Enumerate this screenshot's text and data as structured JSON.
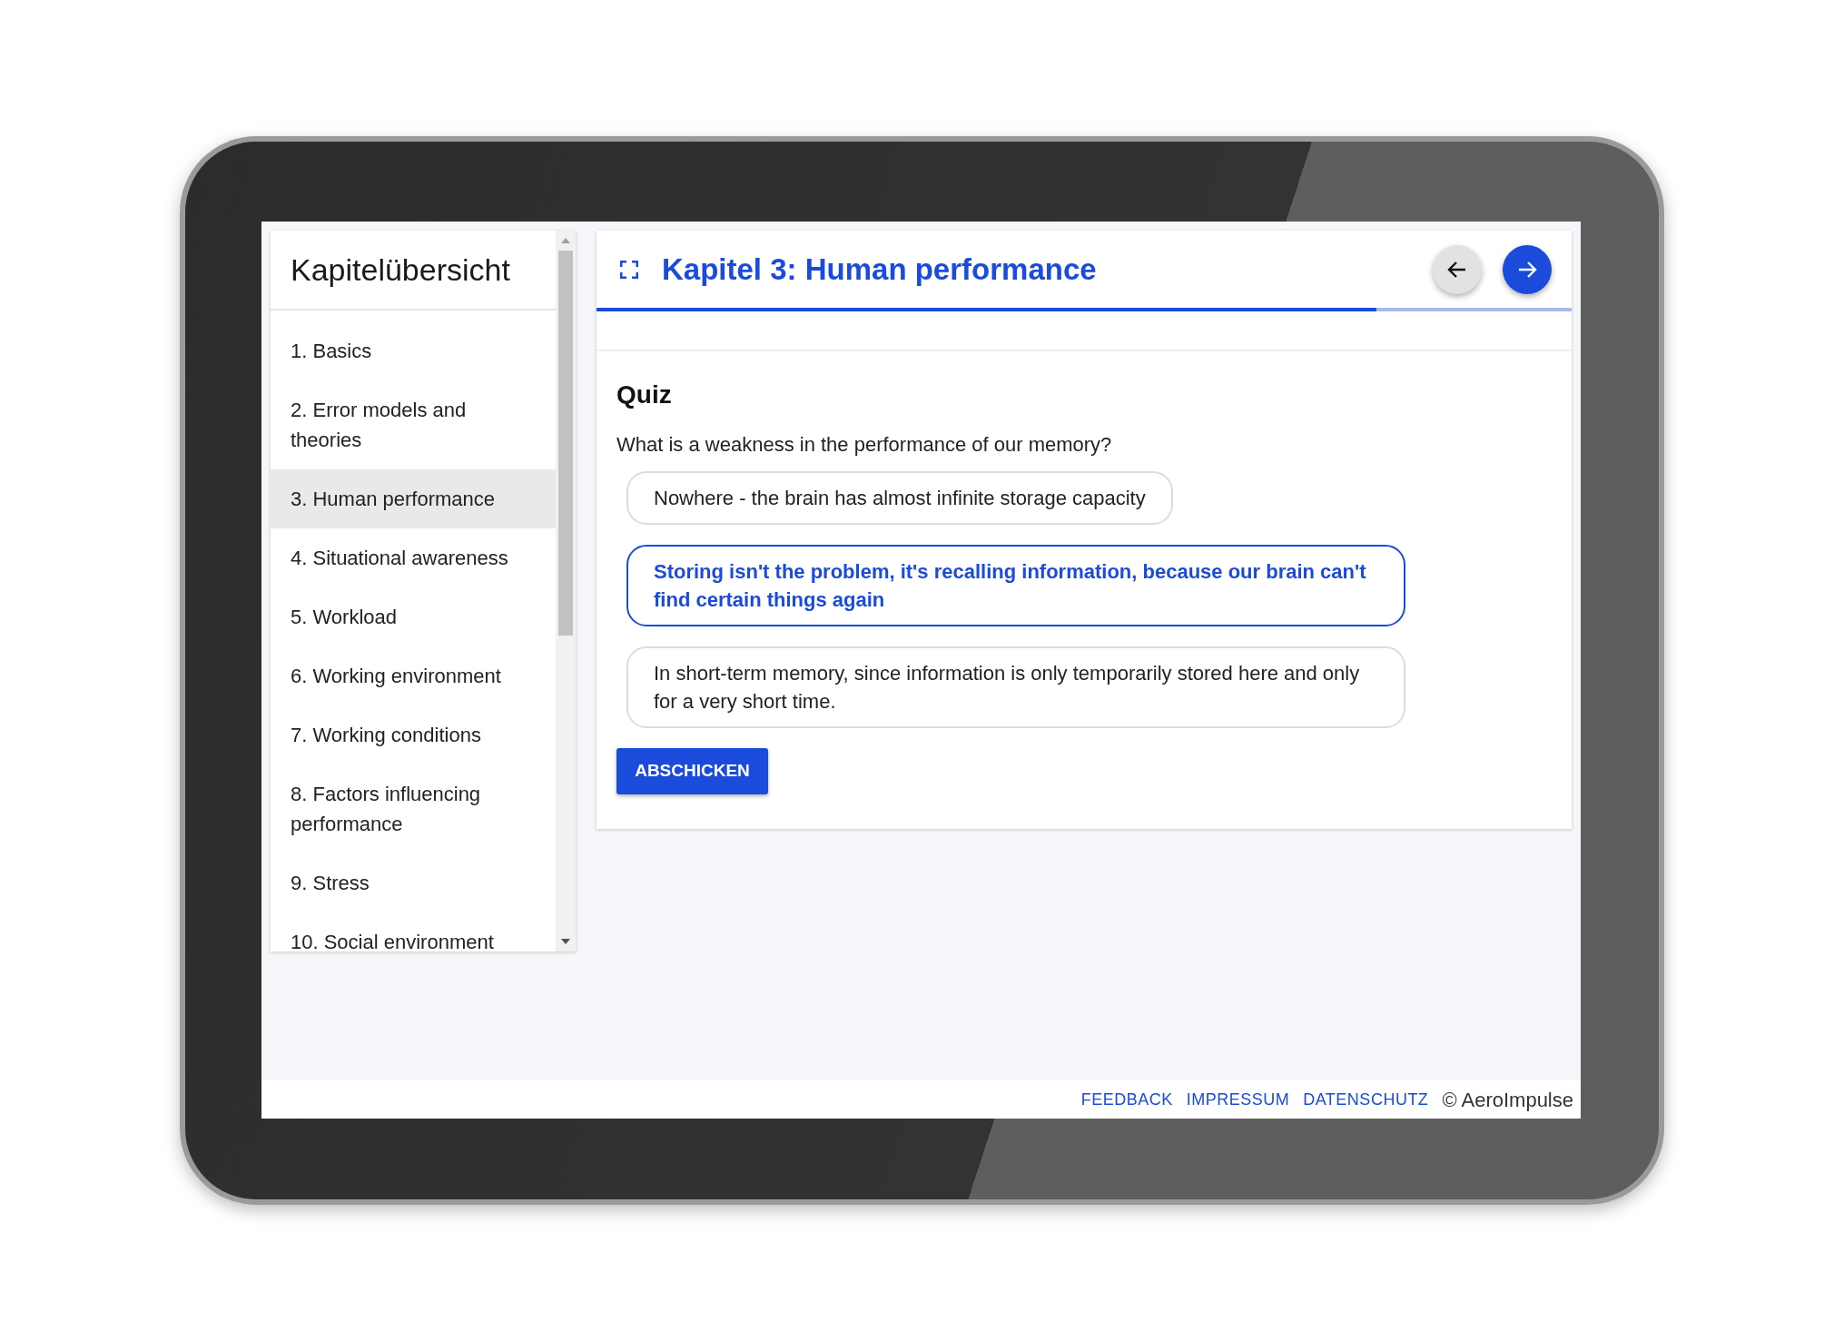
{
  "sidebar": {
    "title": "Kapitelübersicht",
    "items": [
      {
        "label": "1. Basics",
        "selected": false
      },
      {
        "label": "2. Error models and theories",
        "selected": false
      },
      {
        "label": "3. Human performance",
        "selected": true
      },
      {
        "label": "4. Situational awareness",
        "selected": false
      },
      {
        "label": "5. Workload",
        "selected": false
      },
      {
        "label": "6. Working environment",
        "selected": false
      },
      {
        "label": "7. Working conditions",
        "selected": false
      },
      {
        "label": "8. Factors influencing performance",
        "selected": false
      },
      {
        "label": "9. Stress",
        "selected": false
      },
      {
        "label": "10. Social environment",
        "selected": false
      }
    ]
  },
  "header": {
    "title": "Kapitel 3: Human performance",
    "progress": {
      "level": 0.8
    }
  },
  "quiz": {
    "title": "Quiz",
    "question": "What is a weakness in the performance of our memory?",
    "options": [
      {
        "text": "Nowhere - the brain has almost infinite storage capacity",
        "selected": false
      },
      {
        "text": "Storing isn't the problem, it's recalling information, because our brain can't find certain things again",
        "selected": true
      },
      {
        "text": "In short-term memory, since information is only temporarily stored here and only for a very short time.",
        "selected": false
      }
    ],
    "submit": "ABSCHICKEN"
  },
  "footer": {
    "links": [
      "FEEDBACK",
      "IMPRESSUM",
      "DATENSCHUTZ"
    ],
    "copyright": "© AeroImpulse"
  }
}
